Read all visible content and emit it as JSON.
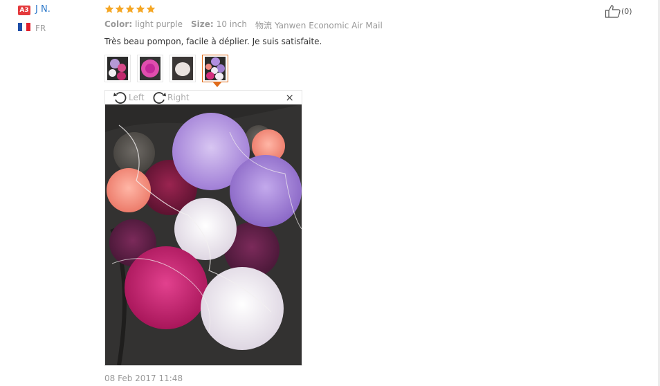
{
  "reviewer": {
    "badge": "A3",
    "name": "J N.",
    "country": "FR",
    "flag_colors": [
      "#1e4fa8",
      "#ffffff",
      "#e2202c"
    ]
  },
  "rating": {
    "stars": 5,
    "max": 5,
    "star_color": "#f5a623"
  },
  "properties": [
    {
      "key": "Color:",
      "value": "light purple"
    },
    {
      "key": "Size:",
      "value": "10 inch"
    },
    {
      "key": "物流",
      "value": "Yanwen Economic Air Mail"
    }
  ],
  "review_text": "Très beau pompon, facile à déplier. Je suis satisfaite.",
  "helpful": {
    "icon": "thumbs-up-icon",
    "count": "(0)"
  },
  "thumbnails": {
    "count": 4,
    "active_index": 4
  },
  "viewer": {
    "rotate_left": "Left",
    "rotate_right": "Right",
    "close": "×"
  },
  "date": "08 Feb 2017 11:48",
  "colors": {
    "link": "#2a77c9",
    "accent": "#e06b1a",
    "badge": "#e4393c"
  }
}
